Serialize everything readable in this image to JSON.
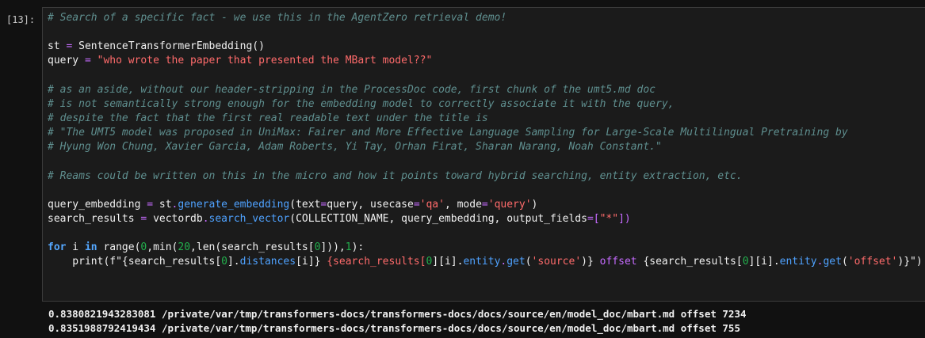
{
  "cell": {
    "prompt": "[13]:",
    "code": {
      "comment1": "# Search of a specific fact - we use this in the AgentZero retrieval demo!",
      "st_assign": "st",
      "eq": "=",
      "st_call": "SentenceTransformerEmbedding()",
      "query_var": "query",
      "query_value": "\"who wrote the paper that presented the MBart model??\"",
      "comments": [
        "# as an aside, without our header-stripping in the ProcessDoc code, first chunk of the umt5.md doc",
        "# is not semantically strong enough for the embedding model to correctly associate it with the query,",
        "# despite the fact that the first real readable text under the title is",
        "# \"The UMT5 model was proposed in UniMax: Fairer and More Effective Language Sampling for Large-Scale Multilingual Pretraining by",
        "# Hyung Won Chung, Xavier Garcia, Adam Roberts, Yi Tay, Orhan Firat, Sharan Narang, Noah Constant.\""
      ],
      "comment_reams": "# Reams could be written on this in the micro and how it points toward hybrid searching, entity extraction, etc.",
      "qe_line": {
        "var": "query_embedding",
        "obj": "st",
        "method": "generate_embedding",
        "args1": "(text",
        "args2": "query, usecase",
        "qa": "'qa'",
        "args3": ", mode",
        "mode": "'query'",
        "close": ")"
      },
      "sr_line": {
        "var": "search_results",
        "obj": "vectordb",
        "method": "search_vector",
        "args1": "(COLLECTION_NAME, query_embedding, output_fields",
        "lb": "[",
        "star": "\"*\"",
        "rb": "])"
      },
      "for_line": {
        "for": "for",
        "i": " i ",
        "in": "in",
        "range": " range(",
        "zero": "0",
        "min": ",min(",
        "twenty": "20",
        "len": ",len(search_results[",
        "zero2": "0",
        "end": "])),",
        "one": "1",
        "close": "):"
      },
      "print_line": {
        "print": "    print(f\"{search_results[",
        "z1": "0",
        "p1": "].",
        "distances": "distances",
        "p2": "[i]}",
        "p3": " {search_results[",
        "z2": "0",
        "p4": "][i].",
        "entity1": "entity",
        "dot1": ".",
        "get1": "get",
        "p5": "(",
        "source": "'source'",
        "p6": ")}",
        "offset_txt": " offset ",
        "p7": "{search_results[",
        "z3": "0",
        "p8": "][i].",
        "entity2": "entity",
        "dot2": ".",
        "get2": "get",
        "p9": "(",
        "offset_str": "'offset'",
        "p10": ")}\")"
      }
    }
  },
  "output": {
    "lines": [
      "0.8380821943283081 /private/var/tmp/transformers-docs/transformers-docs/docs/source/en/model_doc/mbart.md offset 7234",
      "0.8351988792419434 /private/var/tmp/transformers-docs/transformers-docs/docs/source/en/model_doc/mbart.md offset 755"
    ]
  }
}
